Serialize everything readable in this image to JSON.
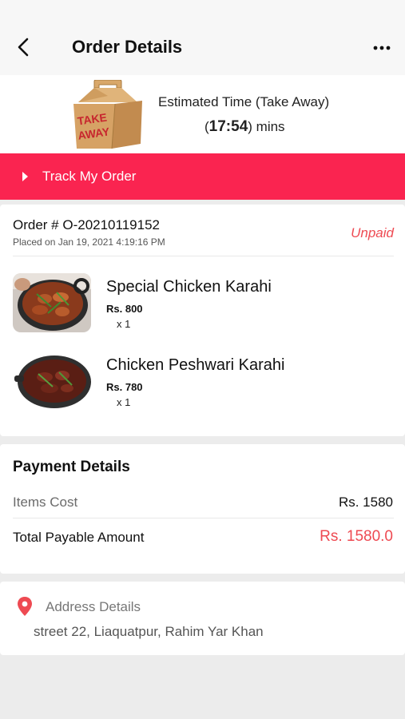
{
  "header": {
    "title": "Order Details",
    "back_icon": "chevron-left-icon",
    "more_icon": "more-horizontal-icon"
  },
  "estimate": {
    "label": "Estimated Time (Take Away)",
    "time_prefix": "(",
    "time_value": "17:54",
    "time_suffix": ") mins",
    "box_text_line1": "TAKE",
    "box_text_line2": "AWAY"
  },
  "track": {
    "label": "Track My Order",
    "icon": "play-triangle-icon",
    "color": "#fa2450"
  },
  "order": {
    "number_label": "Order #  O-20210119152",
    "placed_on": "Placed on Jan 19, 2021 4:19:16 PM",
    "status": "Unpaid",
    "status_color": "#ee4a52",
    "items": [
      {
        "name": "Special Chicken Karahi",
        "price": "Rs. 800",
        "qty": "x 1"
      },
      {
        "name": "Chicken Peshwari Karahi",
        "price": "Rs. 780",
        "qty": "x 1"
      }
    ]
  },
  "payment": {
    "title": "Payment Details",
    "items_cost_label": "Items Cost",
    "items_cost_value": "Rs. 1580",
    "total_label": "Total Payable Amount",
    "total_value": "Rs. 1580.0",
    "total_color": "#ee4a52"
  },
  "address": {
    "title": "Address Details",
    "text": "street 22, Liaquatpur, Rahim Yar Khan",
    "icon": "location-pin-icon"
  }
}
